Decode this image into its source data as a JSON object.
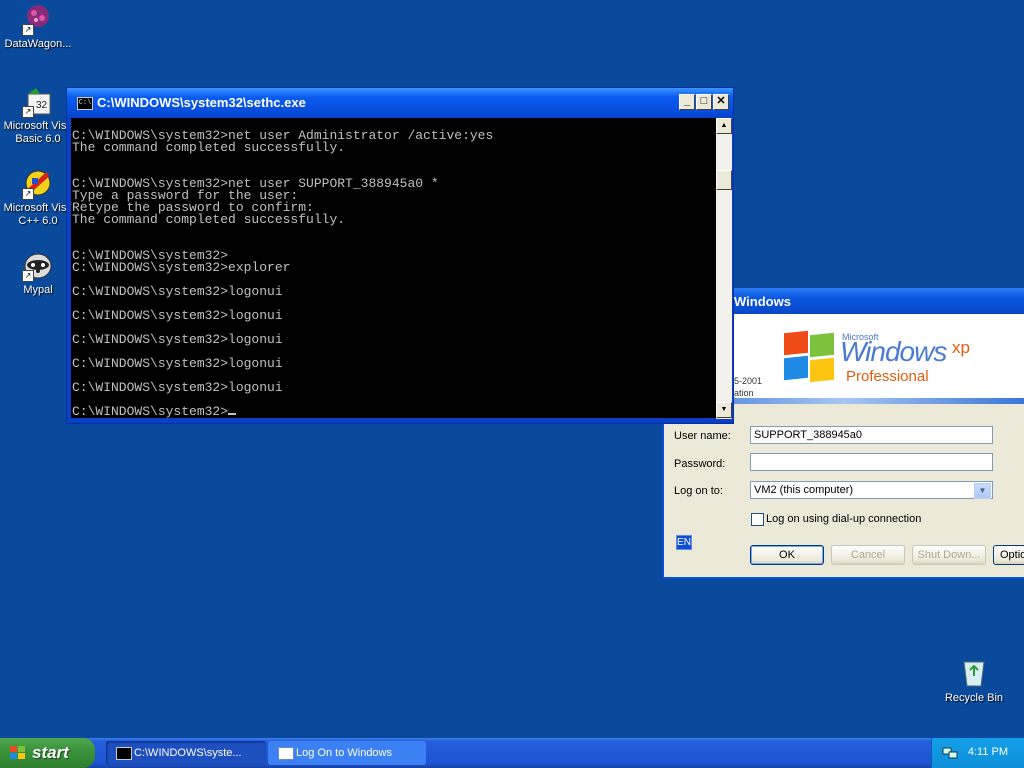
{
  "desktop": {
    "icons": [
      {
        "label": "DataWagon..."
      },
      {
        "label": "Microsoft Visu",
        "label2": "Basic 6.0"
      },
      {
        "label": "Microsoft Visu",
        "label2": "C++ 6.0"
      },
      {
        "label": "Mypal"
      }
    ],
    "recycle_bin": {
      "label": "Recycle Bin"
    }
  },
  "logon_dialog": {
    "title": "Windows",
    "brand": {
      "microsoft": "Microsoft",
      "windows": "Windows",
      "xp": "xp",
      "edition": "Professional"
    },
    "copyright_line1": "5-2001",
    "copyright_line2": "ation",
    "user_name_label": "User name:",
    "user_name_value": "SUPPORT_388945a0",
    "password_label": "Password:",
    "password_value": "",
    "logon_to_label": "Log on to:",
    "logon_to_value": "VM2 (this computer)",
    "dialup_label": "Log on using dial-up connection",
    "language": "EN",
    "ok_label": "OK",
    "cancel_label": "Cancel",
    "shutdown_label": "Shut Down...",
    "options_label": "Optio"
  },
  "console": {
    "title": "C:\\WINDOWS\\system32\\sethc.exe",
    "lines": [
      "",
      "C:\\WINDOWS\\system32>net user Administrator /active:yes",
      "The command completed successfully.",
      "",
      "",
      "C:\\WINDOWS\\system32>net user SUPPORT_388945a0 *",
      "Type a password for the user:",
      "Retype the password to confirm:",
      "The command completed successfully.",
      "",
      "",
      "C:\\WINDOWS\\system32>",
      "C:\\WINDOWS\\system32>explorer",
      "",
      "C:\\WINDOWS\\system32>logonui",
      "",
      "C:\\WINDOWS\\system32>logonui",
      "",
      "C:\\WINDOWS\\system32>logonui",
      "",
      "C:\\WINDOWS\\system32>logonui",
      "",
      "C:\\WINDOWS\\system32>logonui",
      "",
      "C:\\WINDOWS\\system32>"
    ]
  },
  "taskbar": {
    "start_label": "start",
    "tasks": [
      {
        "label": "C:\\WINDOWS\\syste..."
      },
      {
        "label": "Log On to Windows"
      }
    ],
    "clock": "4:11 PM"
  }
}
